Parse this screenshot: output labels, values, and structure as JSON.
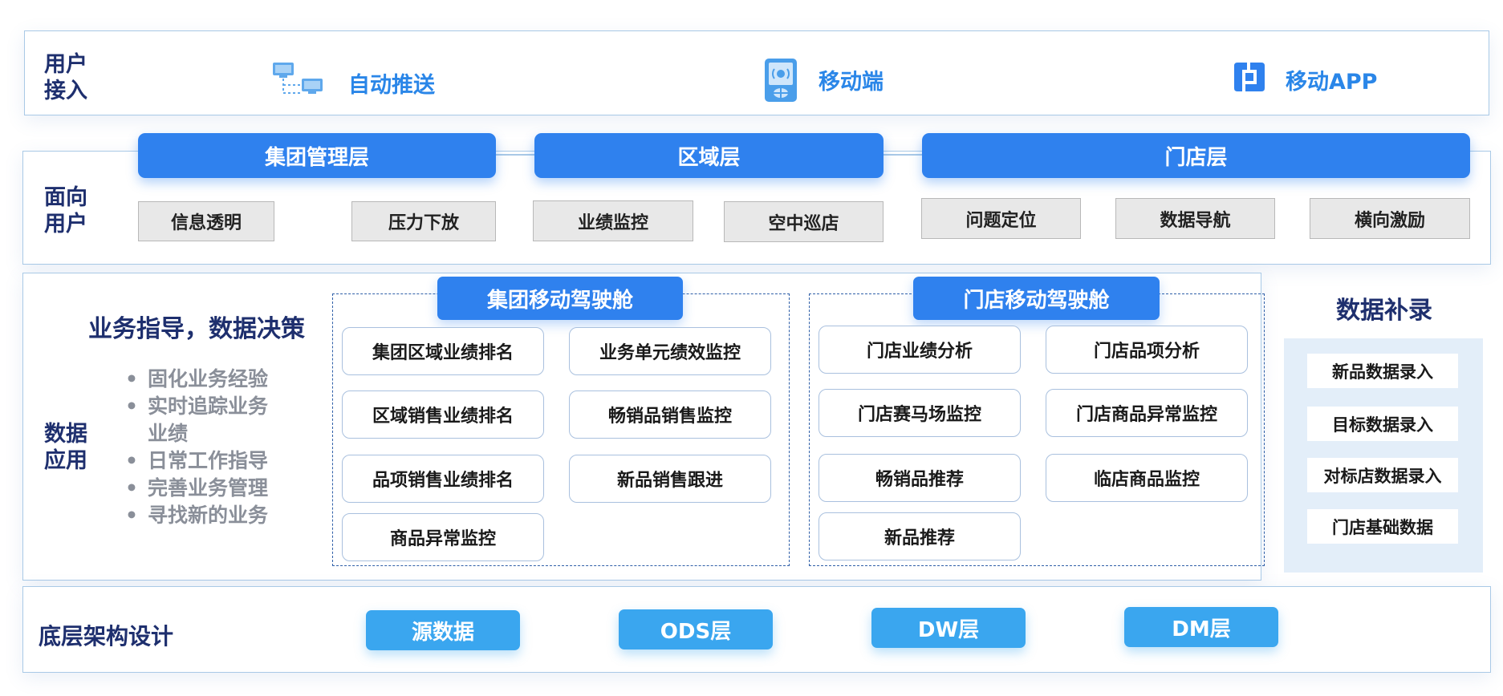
{
  "access": {
    "label": "用户\n接入",
    "items": [
      {
        "icon": "computer-network-icon",
        "label": "自动推送"
      },
      {
        "icon": "mobile-device-icon",
        "label": "移动端"
      },
      {
        "icon": "app-logo-icon",
        "label": "移动APP"
      }
    ]
  },
  "users": {
    "label": "面向\n用户",
    "tiers": [
      "集团管理层",
      "区域层",
      "门店层"
    ],
    "features": [
      "信息透明",
      "压力下放",
      "业绩监控",
      "空中巡店",
      "问题定位",
      "数据导航",
      "横向激励"
    ]
  },
  "apps": {
    "label": "数据\n应用",
    "heading": "业务指导，数据决策",
    "bullets": [
      "固化业务经验",
      "实时追踪业务",
      "业绩",
      "日常工作指导",
      "完善业务管理",
      "寻找新的业务"
    ],
    "group_cockpit": {
      "title": "集团移动驾驶舱",
      "items": [
        "集团区域业绩排名",
        "业务单元绩效监控",
        "区域销售业绩排名",
        "畅销品销售监控",
        "品项销售业绩排名",
        "新品销售跟进",
        "商品异常监控"
      ]
    },
    "store_cockpit": {
      "title": "门店移动驾驶舱",
      "items": [
        "门店业绩分析",
        "门店品项分析",
        "门店赛马场监控",
        "门店商品异常监控",
        "畅销品推荐",
        "临店商品监控",
        "新品推荐"
      ]
    },
    "supplement": {
      "title": "数据补录",
      "items": [
        "新品数据录入",
        "目标数据录入",
        "对标店数据录入",
        "门店基础数据"
      ]
    }
  },
  "base": {
    "label": "底层架构设计",
    "layers": [
      "源数据",
      "ODS层",
      "DW层",
      "DM层"
    ]
  },
  "colors": {
    "tier_blue": "#2f81ee",
    "base_blue": "#3aa6ef",
    "label_navy": "#1e2f6e",
    "access_blue": "#2a86e8"
  }
}
